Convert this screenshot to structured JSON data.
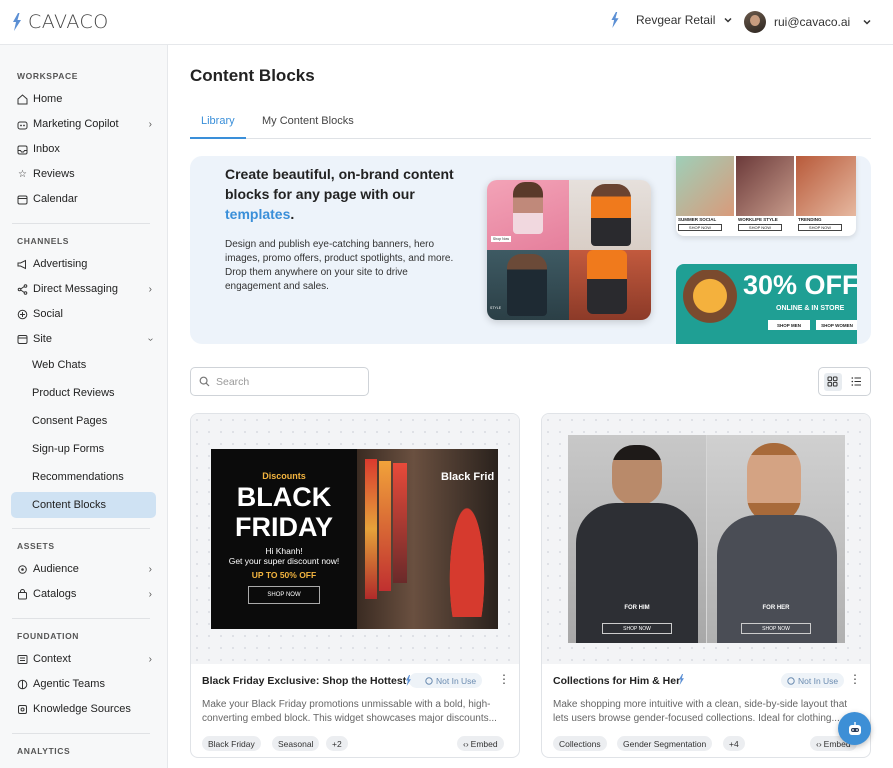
{
  "app": {
    "brand": "CAVACO"
  },
  "header": {
    "org": "Revgear Retail",
    "user_email": "rui@cavaco.ai"
  },
  "sidebar": {
    "workspace_label": "WORKSPACE",
    "workspace": [
      {
        "label": "Home",
        "icon": "home-icon"
      },
      {
        "label": "Marketing Copilot",
        "icon": "robot-icon"
      },
      {
        "label": "Inbox",
        "icon": "inbox-icon"
      },
      {
        "label": "Reviews",
        "icon": "star-icon"
      },
      {
        "label": "Calendar",
        "icon": "calendar-icon"
      }
    ],
    "channels_label": "CHANNELS",
    "channels": [
      {
        "label": "Advertising",
        "icon": "megaphone-icon"
      },
      {
        "label": "Direct Messaging",
        "icon": "share-icon"
      },
      {
        "label": "Social",
        "icon": "social-icon"
      },
      {
        "label": "Site",
        "icon": "site-icon"
      }
    ],
    "site_items": [
      "Web Chats",
      "Product Reviews",
      "Consent Pages",
      "Sign-up Forms",
      "Recommendations",
      "Content Blocks"
    ],
    "assets_label": "ASSETS",
    "assets": [
      {
        "label": "Audience",
        "icon": "audience-icon"
      },
      {
        "label": "Catalogs",
        "icon": "bag-icon"
      }
    ],
    "foundation_label": "FOUNDATION",
    "foundation": [
      {
        "label": "Context",
        "icon": "context-icon"
      },
      {
        "label": "Agentic Teams",
        "icon": "team-icon"
      },
      {
        "label": "Knowledge Sources",
        "icon": "knowledge-icon"
      }
    ],
    "analytics_label": "ANALYTICS"
  },
  "page": {
    "title": "Content Blocks",
    "tabs": [
      "Library",
      "My Content Blocks"
    ],
    "active_tab": "Library"
  },
  "banner": {
    "title_pre": "Create beautiful, on-brand content blocks for any page with our ",
    "title_link": "templates",
    "title_post": ".",
    "description": "Design and publish eye-catching banners, hero images, promo offers, product spotlights, and more. Drop them anywhere on your site to drive engagement and sales.",
    "tiles": {
      "tr_labels": [
        "SUMMER SOCIAL",
        "WORKLIFE STYLE",
        "TRENDING"
      ],
      "tr_btn": "SHOP NOW",
      "br_big": "30% OFF",
      "br_sub": "ONLINE & IN STORE",
      "br_btn1": "SHOP MEN",
      "br_btn2": "SHOP WOMEN",
      "collage_btn": "Shop Now",
      "collage_style": "STYLE"
    }
  },
  "search": {
    "placeholder": "Search"
  },
  "cards": [
    {
      "title": "Black Friday Exclusive: Shop the Hottest ...",
      "status": "Not In Use",
      "description": "Make your Black Friday promotions unmissable with a bold, high-converting embed block. This widget showcases major discounts...",
      "tags": [
        "Black Friday",
        "Seasonal",
        "+2"
      ],
      "embed": "Embed",
      "preview": {
        "kicker": "Discounts",
        "headline_1": "BLACK",
        "headline_2": "FRIDAY",
        "greeting": "Hi Khanh!",
        "offer": "Get your super discount now!",
        "upto": "UP TO 50% OFF",
        "cta": "SHOP NOW",
        "sign": "Black Frid"
      }
    },
    {
      "title": "Collections for Him & Her",
      "status": "Not In Use",
      "description": "Make shopping more intuitive with a clean, side-by-side layout that lets users browse gender-focused collections. Ideal for clothing...",
      "tags": [
        "Collections",
        "Gender Segmentation",
        "+4"
      ],
      "embed": "Embed",
      "preview": {
        "left_label": "FOR HIM",
        "right_label": "FOR HER",
        "cta": "SHOP NOW"
      }
    }
  ],
  "colors": {
    "accent": "#3a8fd9",
    "active_bg": "#cfe2f3",
    "banner_bg": "#edf3fa"
  }
}
